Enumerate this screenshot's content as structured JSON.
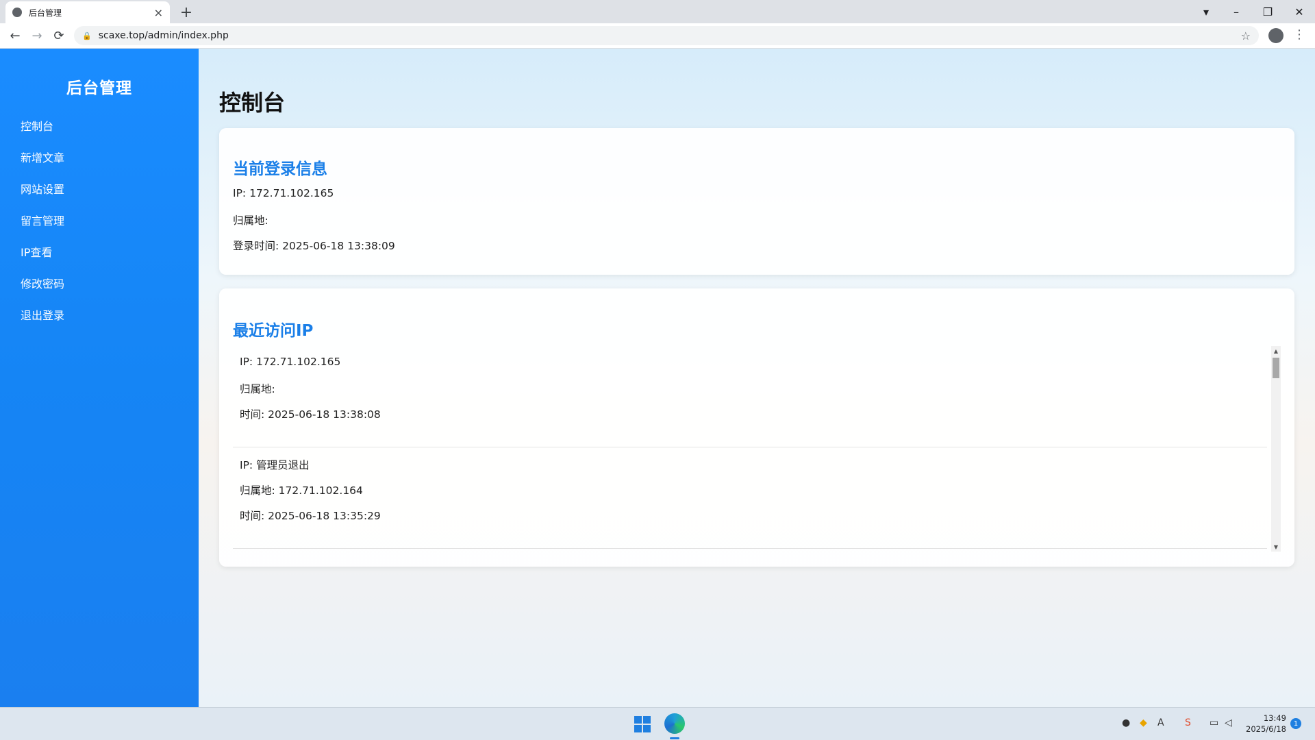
{
  "browser": {
    "tab_title": "后台管理",
    "close_tab_glyph": "×",
    "new_tab_glyph": "+",
    "url": "scaxe.top/admin/index.php",
    "back_glyph": "←",
    "forward_glyph": "→",
    "reload_glyph": "⟳",
    "lock_glyph": "🔒",
    "bookmark_glyph": "☆",
    "menu_glyph": "⋮",
    "window_controls": {
      "tabsearch": "▾",
      "minimize": "–",
      "restore": "❐",
      "close": "✕"
    }
  },
  "sidebar": {
    "title": "后台管理",
    "items": [
      {
        "label": "控制台"
      },
      {
        "label": "新增文章"
      },
      {
        "label": "网站设置"
      },
      {
        "label": "留言管理"
      },
      {
        "label": "IP查看"
      },
      {
        "label": "修改密码"
      },
      {
        "label": "退出登录"
      }
    ]
  },
  "main": {
    "page_title": "控制台",
    "login_card": {
      "title": "当前登录信息",
      "ip": "IP: 172.71.102.165",
      "location": "归属地:",
      "login_time": "登录时间: 2025-06-18 13:38:09"
    },
    "recent_card": {
      "title": "最近访问IP",
      "entries": [
        {
          "ip": "IP: 172.71.102.165",
          "location": "归属地:",
          "time": "时间: 2025-06-18 13:38:08"
        },
        {
          "ip": "IP: 管理员退出",
          "location": "归属地: 172.71.102.164",
          "time": "时间: 2025-06-18 13:35:29"
        }
      ]
    }
  },
  "taskbar": {
    "time": "13:49",
    "date": "2025/6/18",
    "notification_count": "1",
    "tray_icons": [
      "qq-icon",
      "wechat-icon",
      "ime-icon",
      "wps-icon",
      "network-icon",
      "volume-icon"
    ]
  },
  "colors": {
    "sidebar_bg": "#1a8cff",
    "card_title": "#1a7fe8",
    "accent": "#1f7fe0"
  }
}
